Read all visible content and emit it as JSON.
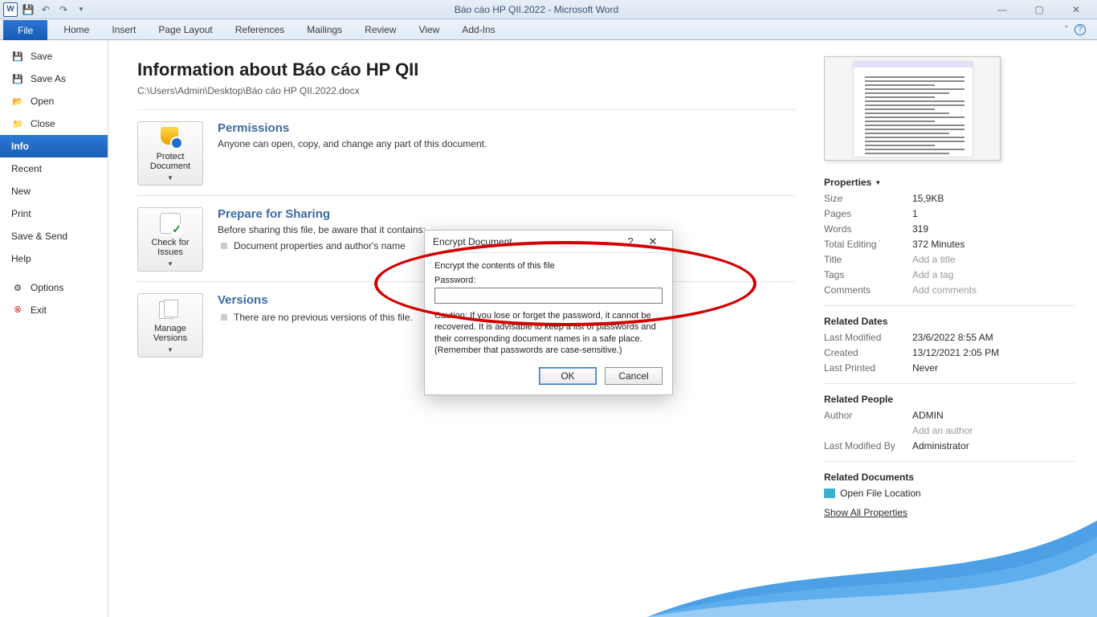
{
  "window": {
    "title": "Báo cáo HP QII.2022  -  Microsoft Word"
  },
  "ribbon_tabs": {
    "file": "File",
    "home": "Home",
    "insert": "Insert",
    "page_layout": "Page Layout",
    "references": "References",
    "mailings": "Mailings",
    "review": "Review",
    "view": "View",
    "addins": "Add-Ins"
  },
  "sidebar": {
    "save": "Save",
    "save_as": "Save As",
    "open": "Open",
    "close": "Close",
    "info": "Info",
    "recent": "Recent",
    "new": "New",
    "print": "Print",
    "save_send": "Save & Send",
    "help": "Help",
    "options": "Options",
    "exit": "Exit"
  },
  "info": {
    "heading": "Information about Báo cáo HP QII",
    "path": "C:\\Users\\Admin\\Desktop\\Báo cáo HP QII.2022.docx",
    "permissions": {
      "title": "Permissions",
      "desc": "Anyone can open, copy, and change any part of this document.",
      "btn": "Protect Document"
    },
    "prepare": {
      "title": "Prepare for Sharing",
      "desc": "Before sharing this file, be aware that it contains:",
      "bullet": "Document properties and author's name",
      "btn": "Check for Issues"
    },
    "versions": {
      "title": "Versions",
      "desc": "There are no previous versions of this file.",
      "btn": "Manage Versions"
    }
  },
  "properties": {
    "header": "Properties",
    "size_k": "Size",
    "size_v": "15,9KB",
    "pages_k": "Pages",
    "pages_v": "1",
    "words_k": "Words",
    "words_v": "319",
    "edit_k": "Total Editing Time",
    "edit_v": "372 Minutes",
    "title_k": "Title",
    "title_v": "Add a title",
    "tags_k": "Tags",
    "tags_v": "Add a tag",
    "comments_k": "Comments",
    "comments_v": "Add comments",
    "dates_header": "Related Dates",
    "modified_k": "Last Modified",
    "modified_v": "23/6/2022 8:55 AM",
    "created_k": "Created",
    "created_v": "13/12/2021 2:05 PM",
    "printed_k": "Last Printed",
    "printed_v": "Never",
    "people_header": "Related People",
    "author_k": "Author",
    "author_v": "ADMIN",
    "author_add": "Add an author",
    "lastmod_k": "Last Modified By",
    "lastmod_v": "Administrator",
    "docs_header": "Related Documents",
    "open_loc": "Open File Location",
    "show_all": "Show All Properties"
  },
  "dialog": {
    "title": "Encrypt Document",
    "line1": "Encrypt the contents of this file",
    "password_label": "Password:",
    "caution": "Caution: If you lose or forget the password, it cannot be recovered. It is advisable to keep a list of passwords and their corresponding document names in a safe place. (Remember that passwords are case-sensitive.)",
    "ok": "OK",
    "cancel": "Cancel"
  }
}
